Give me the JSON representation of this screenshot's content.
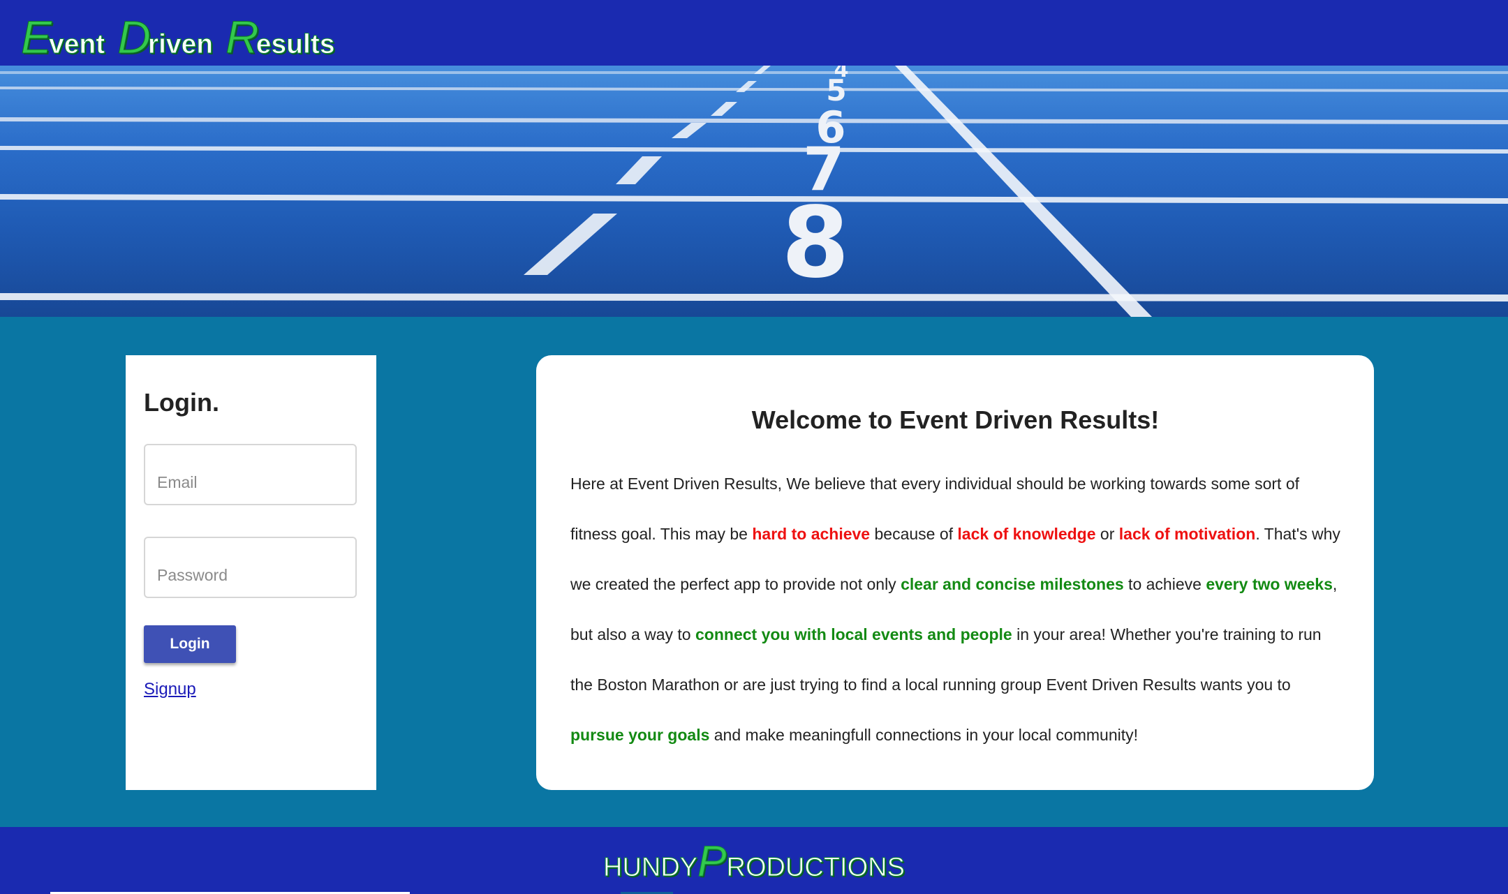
{
  "header": {
    "logo": {
      "word1_cap": "E",
      "word1_rest": "vent",
      "word2_cap": "D",
      "word2_rest": "riven",
      "word3_cap": "R",
      "word3_rest": "esults"
    }
  },
  "hero": {
    "lane_numbers": [
      "4",
      "5",
      "6",
      "7",
      "8"
    ]
  },
  "login": {
    "title": "Login.",
    "email_placeholder": "Email",
    "password_placeholder": "Password",
    "login_button": "Login",
    "signup_link": "Signup"
  },
  "welcome": {
    "title": "Welcome to Event Driven Results!",
    "segments": [
      {
        "text": "Here at Event Driven Results, We believe that every individual should be working towards some sort of fitness goal. This may be ",
        "style": "normal"
      },
      {
        "text": "hard to achieve",
        "style": "red"
      },
      {
        "text": " because of ",
        "style": "normal"
      },
      {
        "text": "lack of knowledge",
        "style": "red"
      },
      {
        "text": " or ",
        "style": "normal"
      },
      {
        "text": "lack of motivation",
        "style": "red"
      },
      {
        "text": ". That's why we created the perfect app to provide not only ",
        "style": "normal"
      },
      {
        "text": "clear and concise milestones",
        "style": "green"
      },
      {
        "text": " to achieve ",
        "style": "normal"
      },
      {
        "text": "every two weeks",
        "style": "green"
      },
      {
        "text": ", but also a way to ",
        "style": "normal"
      },
      {
        "text": "connect you with local events and people",
        "style": "green"
      },
      {
        "text": " in your area! Whether you're training to run the Boston Marathon or are just trying to find a local running group Event Driven Results wants you to ",
        "style": "normal"
      },
      {
        "text": "pursue your goals",
        "style": "green"
      },
      {
        "text": " and make meaningfull connections in your local community!",
        "style": "normal"
      }
    ]
  },
  "footer": {
    "brand_part1": "HUNDY",
    "brand_cap": "P",
    "brand_part2": "RODUCTIONS"
  },
  "colors": {
    "header_bg": "#1a2ab0",
    "page_bg": "#0a76a3",
    "accent_green": "#33c94d",
    "highlight_red": "#ee1111",
    "highlight_green": "#138a13",
    "button": "#3f51b5"
  }
}
